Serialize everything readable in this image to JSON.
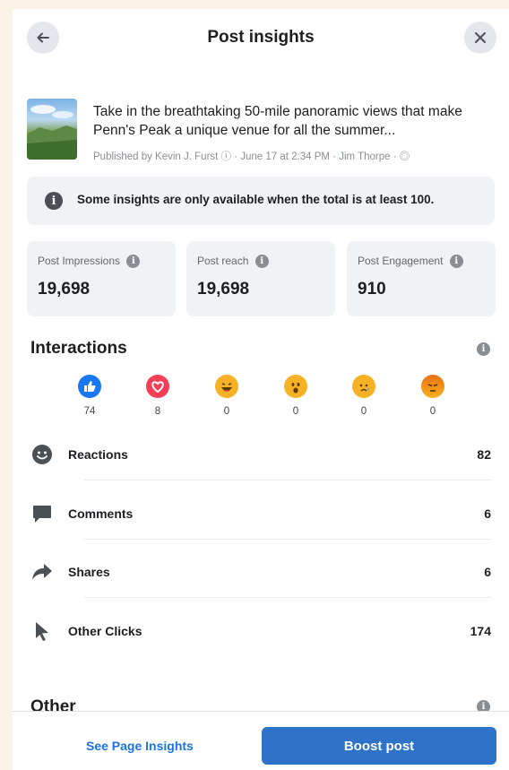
{
  "header": {
    "title": "Post insights",
    "back_icon": "arrow-left-icon",
    "close_icon": "close-icon"
  },
  "post": {
    "text": "Take in the breathtaking 50-mile panoramic views that make Penn's Peak a unique venue for all the summer...",
    "meta": "Published by Kevin J. Furst ⓘ · June 17 at 2:34 PM · Jim Thorpe · ◎"
  },
  "notice": {
    "text": "Some insights are only available when the total is at least 100."
  },
  "stats": [
    {
      "label": "Post Impressions",
      "value": "19,698"
    },
    {
      "label": "Post reach",
      "value": "19,698"
    },
    {
      "label": "Post Engagement",
      "value": "910"
    }
  ],
  "interactions": {
    "title": "Interactions",
    "reactions": [
      {
        "icon": "like-icon",
        "count": "74",
        "color": "#1877f2"
      },
      {
        "icon": "love-icon",
        "count": "8",
        "color": "#f33e58"
      },
      {
        "icon": "haha-icon",
        "count": "0",
        "color": "#f7b125"
      },
      {
        "icon": "wow-icon",
        "count": "0",
        "color": "#f7b125"
      },
      {
        "icon": "sad-icon",
        "count": "0",
        "color": "#f7b125"
      },
      {
        "icon": "angry-icon",
        "count": "0",
        "color": "#e9710f"
      }
    ],
    "rows": [
      {
        "icon": "smiley-icon",
        "label": "Reactions",
        "value": "82"
      },
      {
        "icon": "comment-icon",
        "label": "Comments",
        "value": "6"
      },
      {
        "icon": "share-icon",
        "label": "Shares",
        "value": "6"
      },
      {
        "icon": "cursor-icon",
        "label": "Other Clicks",
        "value": "174"
      }
    ]
  },
  "other": {
    "title": "Other"
  },
  "footer": {
    "see_page_insights": "See Page Insights",
    "boost_post": "Boost post"
  },
  "colors": {
    "accent": "#1b74e4",
    "boost_button": "#2f72c9",
    "card_background": "#f0f2f5"
  }
}
